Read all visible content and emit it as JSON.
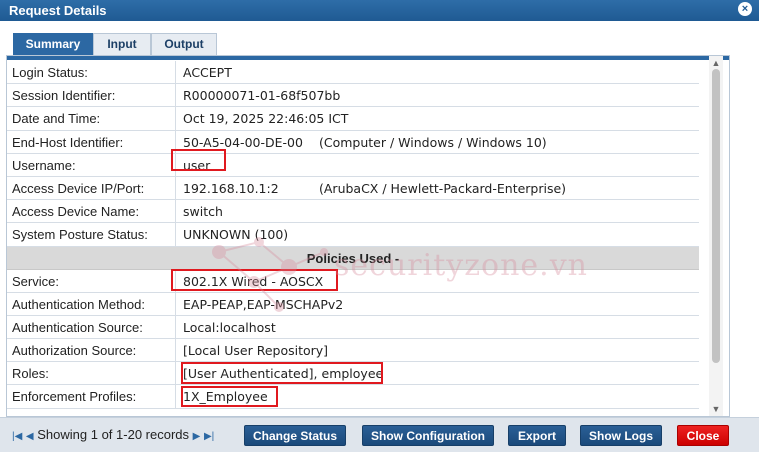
{
  "window": {
    "title": "Request Details",
    "close_icon": "close-icon"
  },
  "tabs": [
    {
      "label": "Summary",
      "active": true
    },
    {
      "label": "Input",
      "active": false
    },
    {
      "label": "Output",
      "active": false
    }
  ],
  "summary": {
    "rows": [
      {
        "key": "Login Status:",
        "value": "ACCEPT"
      },
      {
        "key": "Session Identifier:",
        "value": "R00000071-01-68f507bb"
      },
      {
        "key": "Date and Time:",
        "value": "Oct 19, 2025 22:46:05 ICT"
      },
      {
        "key": "End-Host Identifier:",
        "value": "50-A5-04-00-DE-00",
        "extra": "(Computer / Windows / Windows 10)"
      },
      {
        "key": "Username:",
        "value": "user",
        "highlighted": true
      },
      {
        "key": "Access Device IP/Port:",
        "value": "192.168.10.1:2",
        "extra": "(ArubaCX / Hewlett-Packard-Enterprise)"
      },
      {
        "key": "Access Device Name:",
        "value": "switch"
      },
      {
        "key": "System Posture Status:",
        "value": "UNKNOWN (100)"
      }
    ],
    "section_title": "Policies Used -",
    "policy_rows": [
      {
        "key": "Service:",
        "value": "802.1X Wired - AOSCX",
        "highlighted": true
      },
      {
        "key": "Authentication Method:",
        "value": "EAP-PEAP,EAP-MSCHAPv2"
      },
      {
        "key": "Authentication Source:",
        "value": "Local:localhost"
      },
      {
        "key": "Authorization Source:",
        "value": "[Local User Repository]"
      },
      {
        "key": "Roles:",
        "value": "[User Authenticated], employee",
        "highlighted": true
      },
      {
        "key": "Enforcement Profiles:",
        "value": "1X_Employee",
        "highlighted": true
      }
    ]
  },
  "watermark": {
    "text": "securityzone.vn"
  },
  "footer": {
    "pager_text": "Showing 1 of 1-20 records",
    "buttons": {
      "change_status": "Change Status",
      "show_configuration": "Show Configuration",
      "export": "Export",
      "show_logs": "Show Logs",
      "close": "Close"
    }
  },
  "colors": {
    "accent": "#2c68a3",
    "highlight": "#e0191f",
    "close_button": "#dd1111"
  }
}
